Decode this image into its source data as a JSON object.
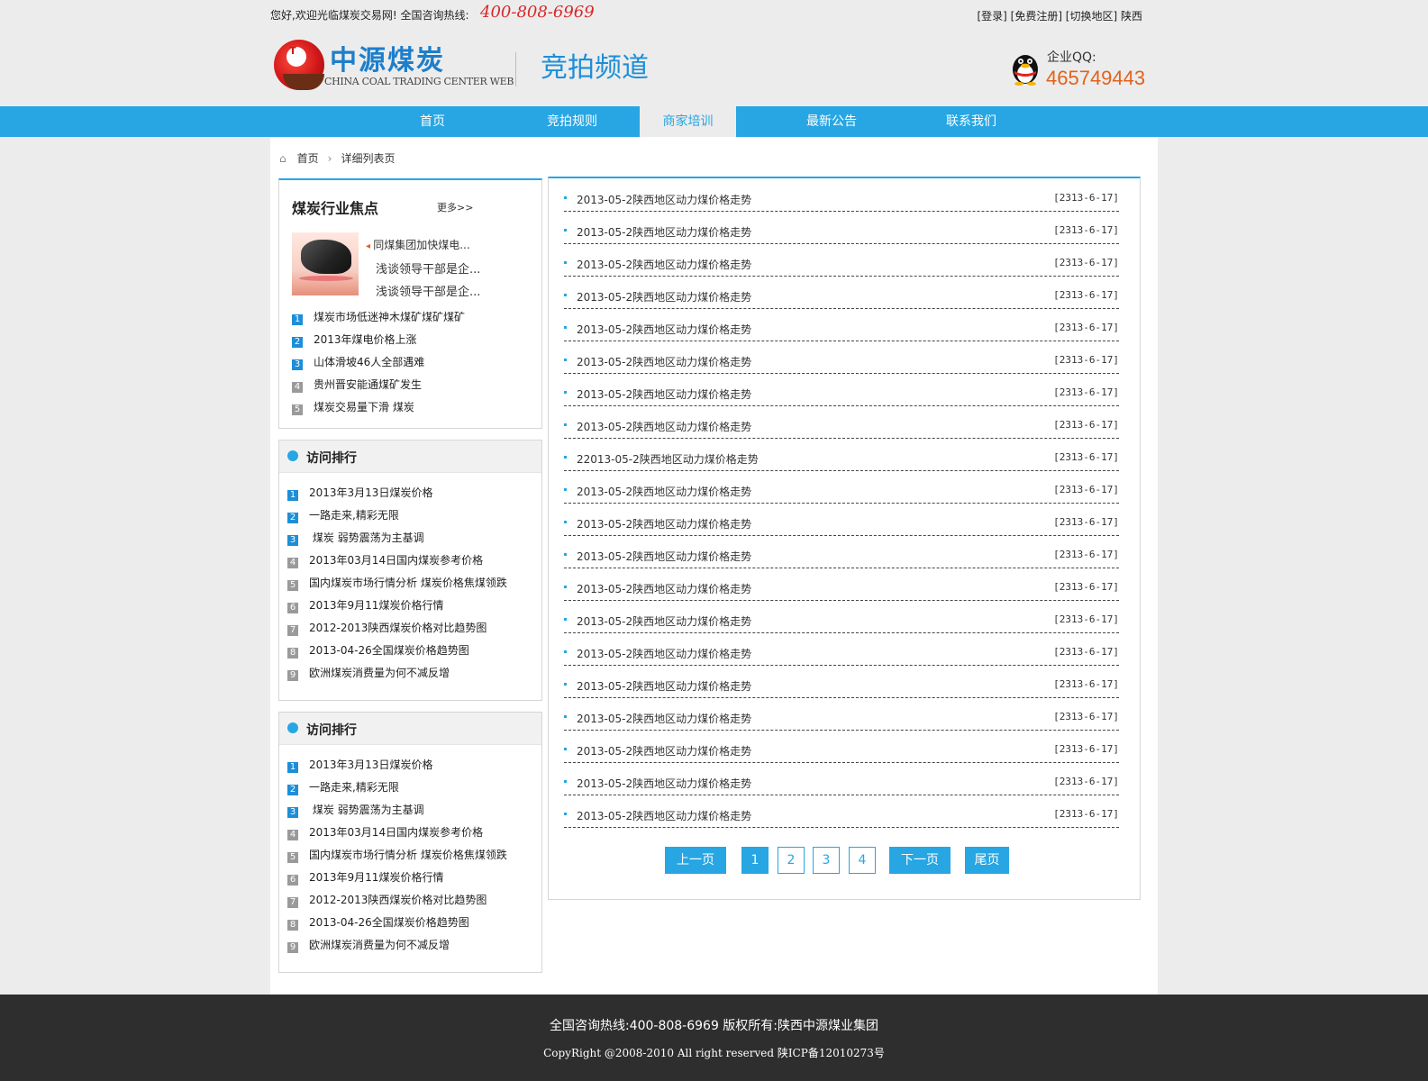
{
  "topbar": {
    "welcome": "您好,欢迎光临煤炭交易网! 全国咨询热线:",
    "hotline": "400-808-6969",
    "links": "[登录] [免费注册] [切换地区] 陕西"
  },
  "header": {
    "logo_cn": "中源煤炭",
    "logo_en": "CHINA COAL TRADING CENTER WEB",
    "channel": "竞拍频道",
    "qq_label": "企业QQ:",
    "qq_number": "465749443"
  },
  "nav": [
    "首页",
    "竞拍规则",
    "商家培训",
    "最新公告",
    "联系我们"
  ],
  "nav_active": "商家培训",
  "breadcrumb": {
    "home": "首页",
    "current": "详细列表页"
  },
  "focus": {
    "title": "煤炭行业焦点",
    "more": "更多>>",
    "links": [
      "同煤集团加快煤电...",
      "浅谈领导干部是企...",
      "浅谈领导干部是企..."
    ],
    "ranked": [
      {
        "num": "1",
        "text": "煤炭市场低迷神木煤矿煤矿煤矿"
      },
      {
        "num": "2",
        "text": "2013年煤电价格上涨"
      },
      {
        "num": "3",
        "text": "山体滑坡46人全部遇难"
      },
      {
        "num": "4",
        "text": "贵州晋安能通煤矿发生"
      },
      {
        "num": "5",
        "text": "煤炭交易量下滑  煤炭"
      }
    ]
  },
  "rank1": {
    "title": "访问排行",
    "items": [
      {
        "num": "1",
        "text": "2013年3月13日煤炭价格"
      },
      {
        "num": "2",
        "text": "一路走来,精彩无限"
      },
      {
        "num": "3",
        "text": " 煤炭 弱势震荡为主基调"
      },
      {
        "num": "4",
        "text": "2013年03月14日国内煤炭参考价格"
      },
      {
        "num": "5",
        "text": "国内煤炭市场行情分析   煤炭价格焦煤领跌"
      },
      {
        "num": "6",
        "text": "2013年9月11煤炭价格行情"
      },
      {
        "num": "7",
        "text": "2012-2013陕西煤炭价格对比趋势图"
      },
      {
        "num": "8",
        "text": "2013-04-26全国煤炭价格趋势图"
      },
      {
        "num": "9",
        "text": "欧洲煤炭消费量为何不减反增"
      }
    ]
  },
  "rank2": {
    "title": "访问排行",
    "items": [
      {
        "num": "1",
        "text": "2013年3月13日煤炭价格"
      },
      {
        "num": "2",
        "text": "一路走来,精彩无限"
      },
      {
        "num": "3",
        "text": " 煤炭 弱势震荡为主基调"
      },
      {
        "num": "4",
        "text": "2013年03月14日国内煤炭参考价格"
      },
      {
        "num": "5",
        "text": "国内煤炭市场行情分析   煤炭价格焦煤领跌"
      },
      {
        "num": "6",
        "text": "2013年9月11煤炭价格行情"
      },
      {
        "num": "7",
        "text": "2012-2013陕西煤炭价格对比趋势图"
      },
      {
        "num": "8",
        "text": "2013-04-26全国煤炭价格趋势图"
      },
      {
        "num": "9",
        "text": "欧洲煤炭消费量为何不减反增"
      }
    ]
  },
  "list": [
    {
      "title": "2013-05-2陕西地区动力煤价格走势",
      "date": "[2313-6-17]"
    },
    {
      "title": "2013-05-2陕西地区动力煤价格走势",
      "date": "[2313-6-17]"
    },
    {
      "title": "2013-05-2陕西地区动力煤价格走势",
      "date": "[2313-6-17]"
    },
    {
      "title": "2013-05-2陕西地区动力煤价格走势",
      "date": "[2313-6-17]"
    },
    {
      "title": "2013-05-2陕西地区动力煤价格走势",
      "date": "[2313-6-17]"
    },
    {
      "title": "2013-05-2陕西地区动力煤价格走势",
      "date": "[2313-6-17]"
    },
    {
      "title": "2013-05-2陕西地区动力煤价格走势",
      "date": "[2313-6-17]"
    },
    {
      "title": "2013-05-2陕西地区动力煤价格走势",
      "date": "[2313-6-17]"
    },
    {
      "title": "22013-05-2陕西地区动力煤价格走势",
      "date": "[2313-6-17]"
    },
    {
      "title": "2013-05-2陕西地区动力煤价格走势",
      "date": "[2313-6-17]"
    },
    {
      "title": "2013-05-2陕西地区动力煤价格走势",
      "date": "[2313-6-17]"
    },
    {
      "title": "2013-05-2陕西地区动力煤价格走势",
      "date": "[2313-6-17]"
    },
    {
      "title": "2013-05-2陕西地区动力煤价格走势",
      "date": "[2313-6-17]"
    },
    {
      "title": "2013-05-2陕西地区动力煤价格走势",
      "date": "[2313-6-17]"
    },
    {
      "title": "2013-05-2陕西地区动力煤价格走势",
      "date": "[2313-6-17]"
    },
    {
      "title": "2013-05-2陕西地区动力煤价格走势",
      "date": "[2313-6-17]"
    },
    {
      "title": "2013-05-2陕西地区动力煤价格走势",
      "date": "[2313-6-17]"
    },
    {
      "title": "2013-05-2陕西地区动力煤价格走势",
      "date": "[2313-6-17]"
    },
    {
      "title": "2013-05-2陕西地区动力煤价格走势",
      "date": "[2313-6-17]"
    },
    {
      "title": "2013-05-2陕西地区动力煤价格走势",
      "date": "[2313-6-17]"
    }
  ],
  "pager": {
    "prev": "上一页",
    "pages": [
      "1",
      "2",
      "3",
      "4"
    ],
    "current": "1",
    "next": "下一页",
    "last": "尾页"
  },
  "footer": {
    "line1": "全国咨询热线:400-808-6969   版权所有:陕西中源煤业集团",
    "line2": "CopyRight @2008-2010 All right reserved    陕ICP备12010273号"
  },
  "colors": {
    "accent": "#27a6e3",
    "hotline": "#d7282b",
    "qq": "#e2621b",
    "footer_bg": "#2e2e2e"
  }
}
